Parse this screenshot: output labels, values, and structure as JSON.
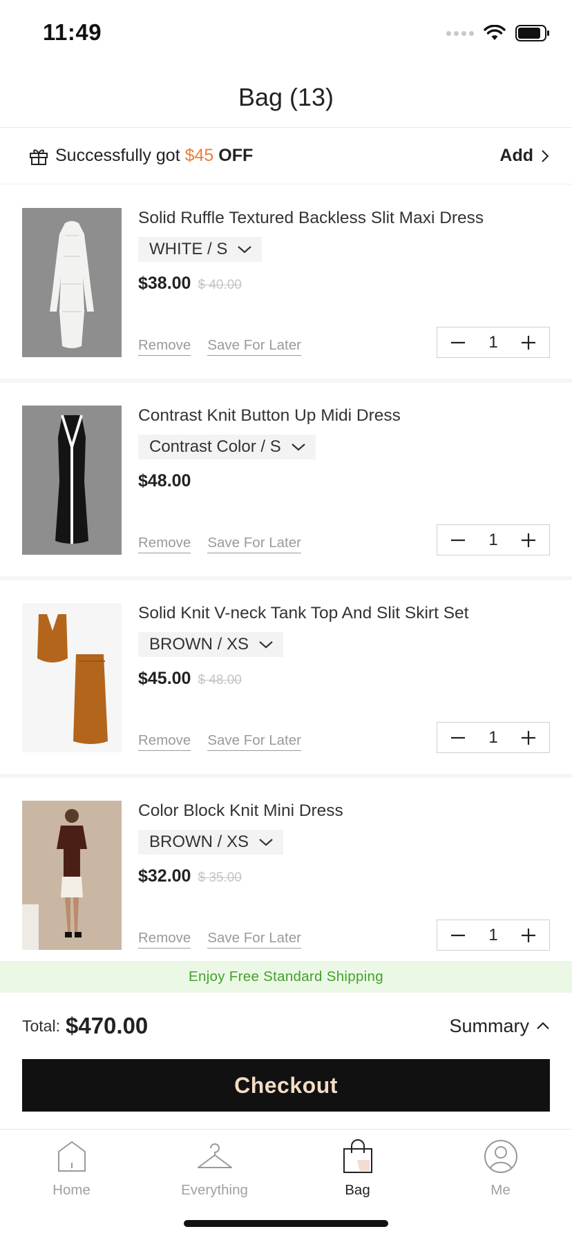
{
  "status_bar": {
    "time": "11:49"
  },
  "header": {
    "title": "Bag (13)"
  },
  "promo": {
    "prefix": "Successfully got",
    "amount": "$45",
    "suffix": "OFF",
    "action": "Add"
  },
  "items": [
    {
      "title": "Solid Ruffle Textured Backless Slit Maxi Dress",
      "variant": "WHITE / S",
      "price": "$38.00",
      "old_price": "$ 40.00",
      "quantity": "1",
      "remove": "Remove",
      "save": "Save For Later"
    },
    {
      "title": "Contrast Knit Button Up Midi Dress",
      "variant": "Contrast Color / S",
      "price": "$48.00",
      "old_price": "",
      "quantity": "1",
      "remove": "Remove",
      "save": "Save For Later"
    },
    {
      "title": "Solid Knit V-neck Tank Top And Slit Skirt Set",
      "variant": "BROWN / XS",
      "price": "$45.00",
      "old_price": "$ 48.00",
      "quantity": "1",
      "remove": "Remove",
      "save": "Save For Later"
    },
    {
      "title": "Color Block Knit Mini Dress",
      "variant": "BROWN / XS",
      "price": "$32.00",
      "old_price": "$ 35.00",
      "quantity": "1",
      "remove": "Remove",
      "save": "Save For Later"
    }
  ],
  "shipping_banner": "Enjoy Free Standard Shipping",
  "totals": {
    "label": "Total:",
    "value": "$470.00",
    "summary": "Summary"
  },
  "checkout": "Checkout",
  "tabs": [
    {
      "label": "Home",
      "icon": "home-icon"
    },
    {
      "label": "Everything",
      "icon": "hanger-icon"
    },
    {
      "label": "Bag",
      "icon": "bag-icon"
    },
    {
      "label": "Me",
      "icon": "user-icon"
    }
  ],
  "colors": {
    "accent": "#ee7c38",
    "shipping_text": "#43a129",
    "shipping_bg": "#ebf8e6",
    "checkout_bg": "#111111",
    "checkout_text": "#f3dcc4"
  }
}
